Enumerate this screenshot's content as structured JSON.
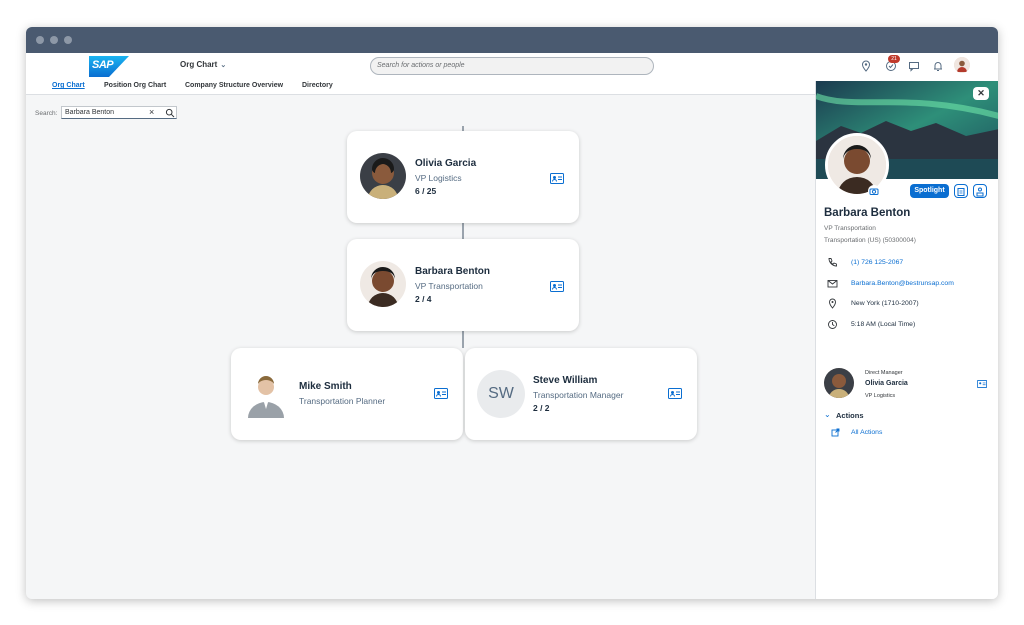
{
  "shell": {
    "logo_text": "SAP",
    "app_title": "Org Chart",
    "search_placeholder": "Search for actions or people",
    "notification_count": "21"
  },
  "tabs": [
    {
      "label": "Org Chart",
      "active": true
    },
    {
      "label": "Position Org Chart",
      "active": false
    },
    {
      "label": "Company Structure Overview",
      "active": false
    },
    {
      "label": "Directory",
      "active": false
    }
  ],
  "search": {
    "label": "Search:",
    "value": "Barbara Benton"
  },
  "cards": {
    "olivia": {
      "name": "Olivia Garcia",
      "title": "VP Logistics",
      "count": "6 / 25"
    },
    "barbara": {
      "name": "Barbara Benton",
      "title": "VP Transportation",
      "count": "2 / 4"
    },
    "mike": {
      "name": "Mike Smith",
      "title": "Transportation Planner"
    },
    "steve": {
      "initials": "SW",
      "name": "Steve William",
      "title": "Transportation Manager",
      "count": "2 / 2"
    }
  },
  "panel": {
    "spotlight_label": "Spotlight",
    "name": "Barbara Benton",
    "title": "VP Transportation",
    "department": "Transportation (US) (50300004)",
    "phone": "(1) 726 125-2067",
    "email": "Barbara.Benton@bestrunsap.com",
    "location": "New York (1710-2007)",
    "local_time": "5:18 AM (Local Time)",
    "manager_label": "Direct Manager",
    "manager_name": "Olivia Garcia",
    "manager_title": "VP Logistics",
    "actions_heading": "Actions",
    "all_actions": "All Actions"
  },
  "colors": {
    "accent": "#0a6ed1",
    "text": "#1d2d3e",
    "muted": "#556b82",
    "titlebar": "#4a5a70"
  }
}
